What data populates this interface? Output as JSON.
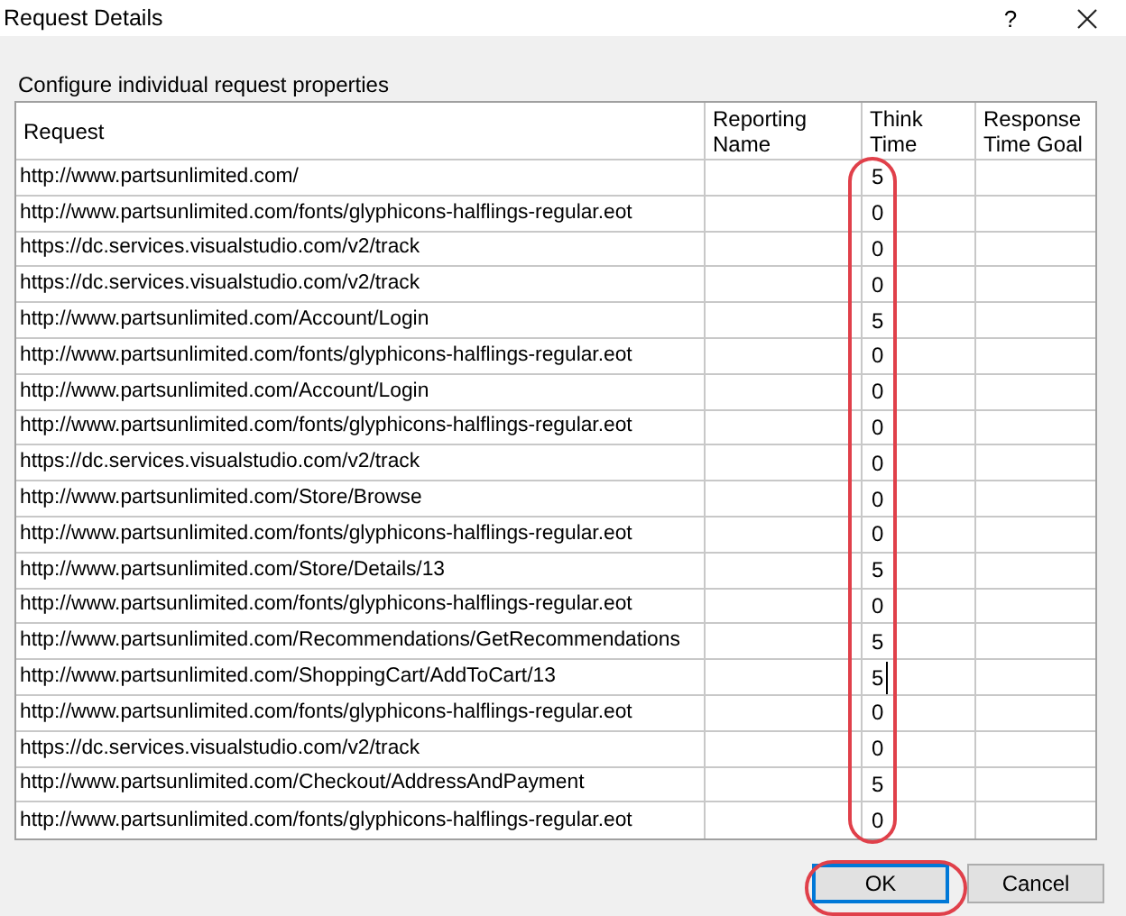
{
  "window": {
    "title": "Request Details",
    "help_button": "?"
  },
  "caption": "Configure individual request properties",
  "table": {
    "columns": [
      "Request",
      "Reporting Name",
      "Think Time",
      "Response Time Goal"
    ],
    "rows": [
      {
        "request": "http://www.partsunlimited.com/",
        "think_time": "5",
        "editing": false
      },
      {
        "request": "http://www.partsunlimited.com/fonts/glyphicons-halflings-regular.eot",
        "think_time": "0",
        "editing": false
      },
      {
        "request": "https://dc.services.visualstudio.com/v2/track",
        "think_time": "0",
        "editing": false
      },
      {
        "request": "https://dc.services.visualstudio.com/v2/track",
        "think_time": "0",
        "editing": false
      },
      {
        "request": "http://www.partsunlimited.com/Account/Login",
        "think_time": "5",
        "editing": false
      },
      {
        "request": "http://www.partsunlimited.com/fonts/glyphicons-halflings-regular.eot",
        "think_time": "0",
        "editing": false
      },
      {
        "request": "http://www.partsunlimited.com/Account/Login",
        "think_time": "0",
        "editing": false
      },
      {
        "request": "http://www.partsunlimited.com/fonts/glyphicons-halflings-regular.eot",
        "think_time": "0",
        "editing": false
      },
      {
        "request": "https://dc.services.visualstudio.com/v2/track",
        "think_time": "0",
        "editing": false
      },
      {
        "request": "http://www.partsunlimited.com/Store/Browse",
        "think_time": "0",
        "editing": false
      },
      {
        "request": "http://www.partsunlimited.com/fonts/glyphicons-halflings-regular.eot",
        "think_time": "0",
        "editing": false
      },
      {
        "request": "http://www.partsunlimited.com/Store/Details/13",
        "think_time": "5",
        "editing": false
      },
      {
        "request": "http://www.partsunlimited.com/fonts/glyphicons-halflings-regular.eot",
        "think_time": "0",
        "editing": false
      },
      {
        "request": "http://www.partsunlimited.com/Recommendations/GetRecommendations",
        "think_time": "5",
        "editing": false
      },
      {
        "request": "http://www.partsunlimited.com/ShoppingCart/AddToCart/13",
        "think_time": "5",
        "editing": true
      },
      {
        "request": "http://www.partsunlimited.com/fonts/glyphicons-halflings-regular.eot",
        "think_time": "0",
        "editing": false
      },
      {
        "request": "https://dc.services.visualstudio.com/v2/track",
        "think_time": "0",
        "editing": false
      },
      {
        "request": "http://www.partsunlimited.com/Checkout/AddressAndPayment",
        "think_time": "5",
        "editing": false
      },
      {
        "request": "http://www.partsunlimited.com/fonts/glyphicons-halflings-regular.eot",
        "think_time": "0",
        "editing": false
      }
    ]
  },
  "buttons": [
    {
      "label": "OK",
      "default": true
    },
    {
      "label": "Cancel",
      "default": false
    }
  ]
}
